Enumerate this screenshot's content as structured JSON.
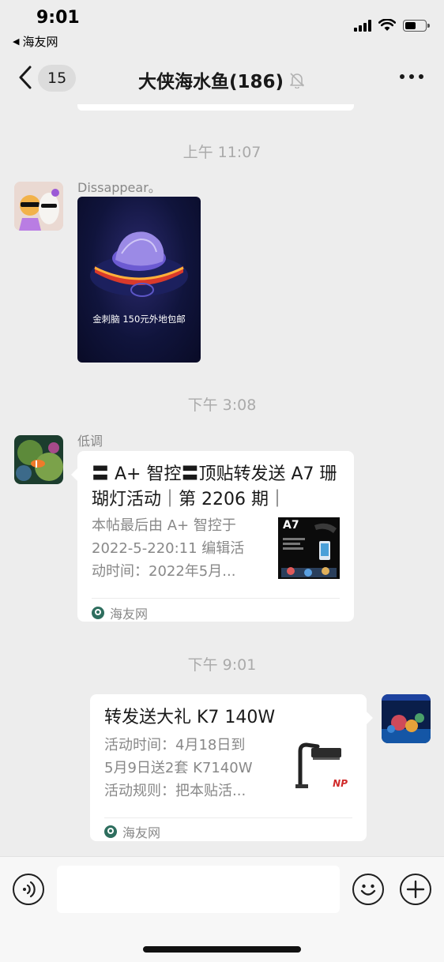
{
  "status_bar": {
    "time": "9:01",
    "back_app": "海友网"
  },
  "nav": {
    "unread_count": "15",
    "title": "大侠海水鱼(186)"
  },
  "messages": {
    "timestamp_1": "上午 11:07",
    "msg1_sender": "Dissappear。",
    "msg1_image_caption": "金刺脑 150元外地包邮",
    "timestamp_2": "下午 3:08",
    "msg2_sender": "低调",
    "msg2_card": {
      "title": "〓 A+ 智控〓顶贴转发送 A7 珊 瑚灯活动｜第 2206 期｜",
      "desc_lines": [
        "本帖最后由 A+ 智控于",
        "2022-5-220:11 编辑活",
        "动时间：2022年5月..."
      ],
      "thumb_text": "A7",
      "source": "海友网"
    },
    "timestamp_3": "下午 9:01",
    "msg3_card": {
      "title": "转发送大礼 K7 140W",
      "desc_lines": [
        "活动时间：4月18日到",
        "5月9日送2套 K7140W",
        "活动规则：把本贴活..."
      ],
      "thumb_text": "NP",
      "source": "海友网"
    }
  },
  "colors": {
    "background": "#ededed",
    "bubble": "#ffffff",
    "meta_text": "#888888"
  }
}
